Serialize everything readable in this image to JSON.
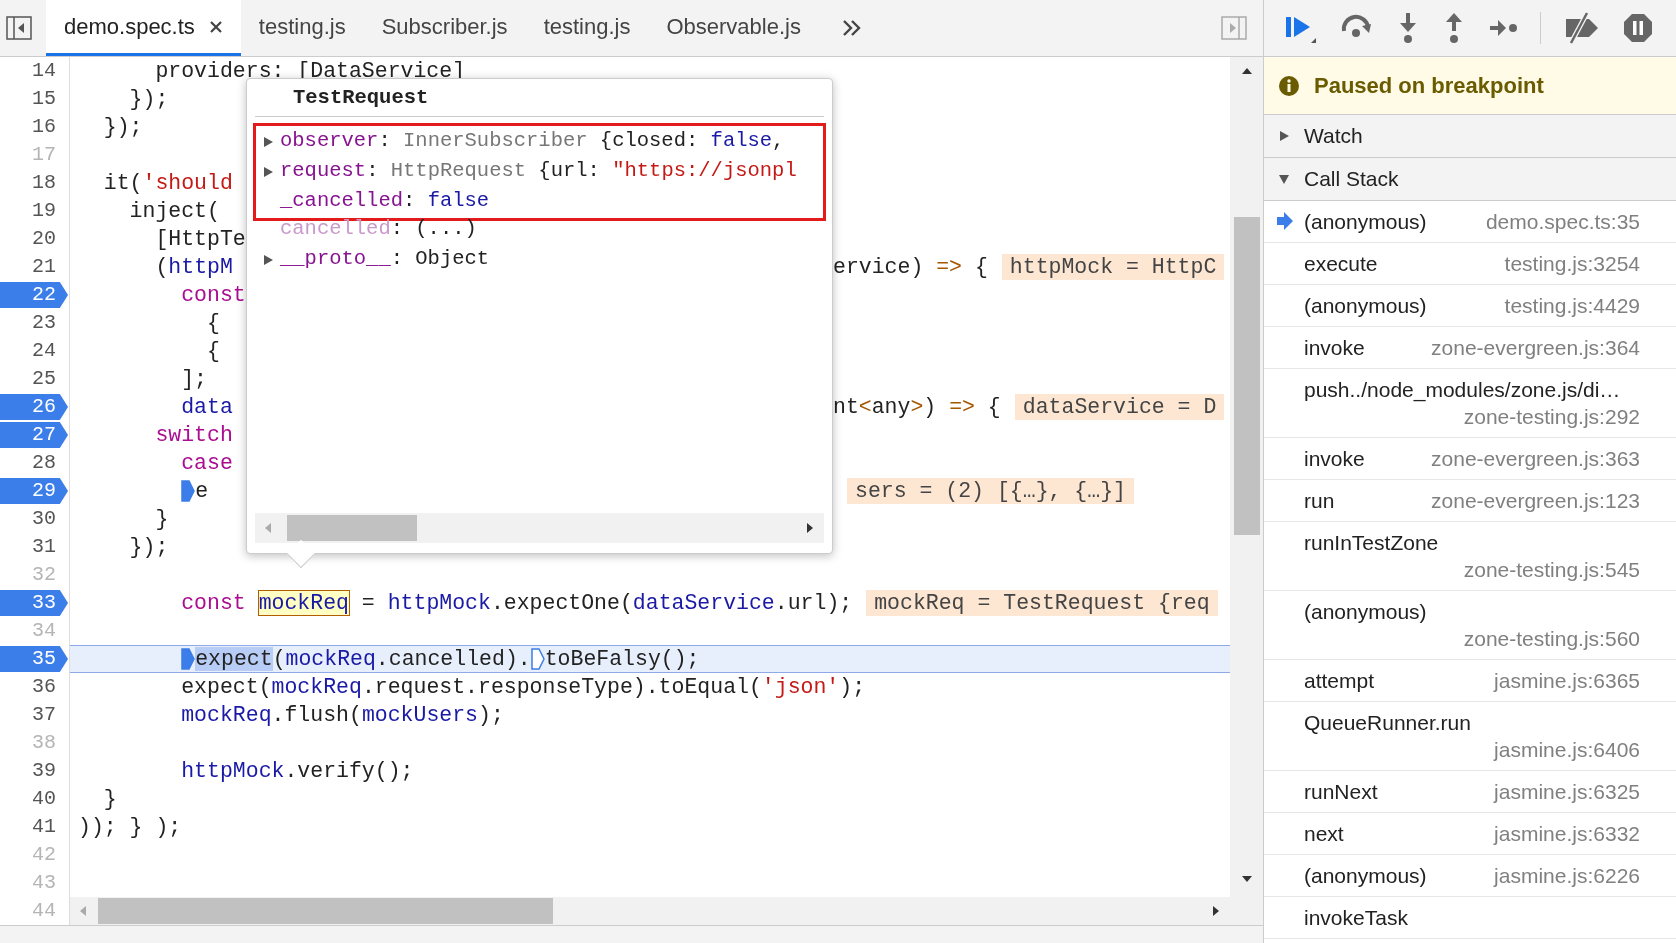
{
  "editor": {
    "tabs": [
      {
        "label": "demo.spec.ts",
        "selected": true,
        "closable": true
      },
      {
        "label": "testing.js",
        "selected": false,
        "closable": false
      },
      {
        "label": "Subscriber.js",
        "selected": false,
        "closable": false
      },
      {
        "label": "testing.js",
        "selected": false,
        "closable": false
      },
      {
        "label": "Observable.js",
        "selected": false,
        "closable": false
      }
    ],
    "lines_above": [
      {
        "number": "14",
        "breakpoint": false,
        "code": [
          {
            "kind": "plain",
            "text": "      providers: [DataService]"
          }
        ]
      }
    ],
    "overlap_lines": [
      {
        "number": "15",
        "breakpoint": false,
        "code": [
          {
            "kind": "plain",
            "text": "    });"
          }
        ]
      },
      {
        "number": "16",
        "breakpoint": false,
        "code": [
          {
            "kind": "plain",
            "text": "  });"
          }
        ]
      },
      {
        "number": "17",
        "breakpoint": false
      },
      {
        "number": "18",
        "breakpoint": false,
        "code": [
          {
            "kind": "plain",
            "text": "  it("
          },
          {
            "kind": "str",
            "text": "'should"
          }
        ]
      },
      {
        "number": "19",
        "breakpoint": false,
        "code": [
          {
            "kind": "plain",
            "text": "    inject("
          }
        ]
      },
      {
        "number": "20",
        "breakpoint": false,
        "code": [
          {
            "kind": "plain",
            "text": "      [HttpTe"
          }
        ]
      },
      {
        "number": "21",
        "breakpoint": false,
        "code": [
          {
            "kind": "plain",
            "text": "      ("
          },
          {
            "kind": "var",
            "text": "httpM"
          }
        ],
        "tail": [
          {
            "kind": "plain",
            "text": "ervice) "
          },
          {
            "kind": "op",
            "text": "=>"
          },
          {
            "kind": "plain",
            "text": " {"
          }
        ],
        "inline_value": "httpMock = HttpC"
      },
      {
        "number": "22",
        "breakpoint": true,
        "code": [
          {
            "kind": "kw",
            "text": "        const"
          }
        ]
      },
      {
        "number": "23",
        "breakpoint": false,
        "code": [
          {
            "kind": "plain",
            "text": "          {"
          }
        ]
      },
      {
        "number": "24",
        "breakpoint": false,
        "code": [
          {
            "kind": "plain",
            "text": "          {"
          }
        ]
      },
      {
        "number": "25",
        "breakpoint": false,
        "code": [
          {
            "kind": "plain",
            "text": "        ];"
          }
        ]
      },
      {
        "number": "26",
        "breakpoint": true,
        "code": [
          {
            "kind": "var",
            "text": "        data"
          }
        ],
        "tail": [
          {
            "kind": "plain",
            "text": "nt"
          },
          {
            "kind": "op",
            "text": "<"
          },
          {
            "kind": "plain",
            "text": "any"
          },
          {
            "kind": "op",
            "text": ">"
          },
          {
            "kind": "plain",
            "text": ") "
          },
          {
            "kind": "op",
            "text": "=>"
          },
          {
            "kind": "plain",
            "text": " {"
          }
        ],
        "inline_value": "dataService = D"
      },
      {
        "number": "27",
        "breakpoint": true,
        "code": [
          {
            "kind": "kw",
            "text": "      switch"
          }
        ]
      },
      {
        "number": "28",
        "breakpoint": false,
        "code": [
          {
            "kind": "kw",
            "text": "        case"
          }
        ]
      },
      {
        "number": "29",
        "breakpoint": true,
        "code": [
          {
            "kind": "marker",
            "active": true
          },
          {
            "kind": "plain",
            "text": "e"
          }
        ],
        "inline_value": "sers = (2) [{…}, {…}]"
      },
      {
        "number": "30",
        "breakpoint": false,
        "code": [
          {
            "kind": "plain",
            "text": "      }"
          }
        ]
      },
      {
        "number": "31",
        "breakpoint": false,
        "code": [
          {
            "kind": "plain",
            "text": "    });"
          }
        ]
      }
    ],
    "popover": {
      "title": "TestRequest",
      "highlighted_properties": [
        {
          "expandable": true,
          "parts": [
            {
              "kind": "key",
              "text": "observer"
            },
            {
              "kind": "plain",
              "text": ": "
            },
            {
              "kind": "type",
              "text": "InnerSubscriber"
            },
            {
              "kind": "plain",
              "text": " {closed: "
            },
            {
              "kind": "bool",
              "text": "false"
            },
            {
              "kind": "plain",
              "text": ","
            }
          ]
        },
        {
          "expandable": true,
          "parts": [
            {
              "kind": "key",
              "text": "request"
            },
            {
              "kind": "plain",
              "text": ": "
            },
            {
              "kind": "type",
              "text": "HttpRequest"
            },
            {
              "kind": "plain",
              "text": " {url: "
            },
            {
              "kind": "str",
              "text": "\"https://jsonpl"
            }
          ]
        },
        {
          "expandable": false,
          "parts": [
            {
              "kind": "key",
              "text": "_cancelled"
            },
            {
              "kind": "plain",
              "text": ": "
            },
            {
              "kind": "bool",
              "text": "false"
            }
          ]
        }
      ],
      "other_properties": [
        {
          "expandable": false,
          "parts": [
            {
              "kind": "dimkey",
              "text": "cancelled"
            },
            {
              "kind": "plain",
              "text": ": (...)"
            }
          ]
        },
        {
          "expandable": true,
          "parts": [
            {
              "kind": "key",
              "text": "__proto__"
            },
            {
              "kind": "plain",
              "text": ": Object"
            }
          ]
        }
      ]
    },
    "lines_below": [
      {
        "number": "32",
        "breakpoint": false,
        "current": false
      },
      {
        "number": "33",
        "breakpoint": true,
        "current": false,
        "code": [
          {
            "kind": "kw",
            "text": "        const "
          },
          {
            "kind": "boxed",
            "text": "mockReq"
          },
          {
            "kind": "plain",
            "text": " = "
          },
          {
            "kind": "var",
            "text": "httpMock"
          },
          {
            "kind": "plain",
            "text": ".expectOne("
          },
          {
            "kind": "var",
            "text": "dataService"
          },
          {
            "kind": "plain",
            "text": ".url);"
          }
        ],
        "inline_value": "mockReq = TestRequest {req"
      },
      {
        "number": "34",
        "breakpoint": false,
        "current": false
      },
      {
        "number": "35",
        "breakpoint": true,
        "current": true,
        "code": [
          {
            "kind": "marker",
            "active": true
          },
          {
            "kind": "sel",
            "text": "expect"
          },
          {
            "kind": "plain",
            "text": "("
          },
          {
            "kind": "var",
            "text": "mockReq"
          },
          {
            "kind": "plain",
            "text": ".cancelled)."
          },
          {
            "kind": "marker",
            "active": false
          },
          {
            "kind": "plain",
            "text": "toBeFalsy();"
          }
        ]
      },
      {
        "number": "36",
        "breakpoint": false,
        "current": false,
        "code": [
          {
            "kind": "plain",
            "text": "        expect("
          },
          {
            "kind": "var",
            "text": "mockReq"
          },
          {
            "kind": "plain",
            "text": ".request.responseType).toEqual("
          },
          {
            "kind": "str",
            "text": "'json'"
          },
          {
            "kind": "plain",
            "text": ");"
          }
        ]
      },
      {
        "number": "37",
        "breakpoint": false,
        "current": false,
        "code": [
          {
            "kind": "var",
            "text": "        mockReq"
          },
          {
            "kind": "plain",
            "text": ".flush("
          },
          {
            "kind": "var",
            "text": "mockUsers"
          },
          {
            "kind": "plain",
            "text": ");"
          }
        ]
      },
      {
        "number": "38",
        "breakpoint": false,
        "current": false
      },
      {
        "number": "39",
        "breakpoint": false,
        "current": false,
        "code": [
          {
            "kind": "var",
            "text": "        httpMock"
          },
          {
            "kind": "plain",
            "text": ".verify();"
          }
        ]
      },
      {
        "number": "40",
        "breakpoint": false,
        "current": false,
        "code": [
          {
            "kind": "plain",
            "text": "  }"
          }
        ]
      },
      {
        "number": "41",
        "breakpoint": false,
        "current": false,
        "code": [
          {
            "kind": "plain",
            "text": ")); } );"
          }
        ]
      },
      {
        "number": "42",
        "breakpoint": false,
        "current": false
      },
      {
        "number": "43",
        "breakpoint": false,
        "current": false
      }
    ],
    "scroll_row_number": "44"
  },
  "debugger": {
    "banner": "Paused on breakpoint",
    "sections": [
      {
        "title": "Watch",
        "expanded": false
      },
      {
        "title": "Call Stack",
        "expanded": true
      }
    ],
    "call_stack": [
      {
        "name": "(anonymous)",
        "location": "demo.spec.ts:35",
        "selected": true
      },
      {
        "name": "execute",
        "location": "testing.js:3254",
        "selected": false
      },
      {
        "name": "(anonymous)",
        "location": "testing.js:4429",
        "selected": false
      },
      {
        "name": "invoke",
        "location": "zone-evergreen.js:364",
        "selected": false
      },
      {
        "name": "push../node_modules/zone.js/di…",
        "location": "zone-testing.js:292",
        "selected": false
      },
      {
        "name": "invoke",
        "location": "zone-evergreen.js:363",
        "selected": false
      },
      {
        "name": "run",
        "location": "zone-evergreen.js:123",
        "selected": false
      },
      {
        "name": "runInTestZone",
        "location": "zone-testing.js:545",
        "selected": false
      },
      {
        "name": "(anonymous)",
        "location": "zone-testing.js:560",
        "selected": false
      },
      {
        "name": "attempt",
        "location": "jasmine.js:6365",
        "selected": false
      },
      {
        "name": "QueueRunner.run",
        "location": "jasmine.js:6406",
        "selected": false
      },
      {
        "name": "runNext",
        "location": "jasmine.js:6325",
        "selected": false
      },
      {
        "name": "next",
        "location": "jasmine.js:6332",
        "selected": false
      },
      {
        "name": "(anonymous)",
        "location": "jasmine.js:6226",
        "selected": false
      },
      {
        "name": "invokeTask",
        "selected": false
      }
    ]
  }
}
